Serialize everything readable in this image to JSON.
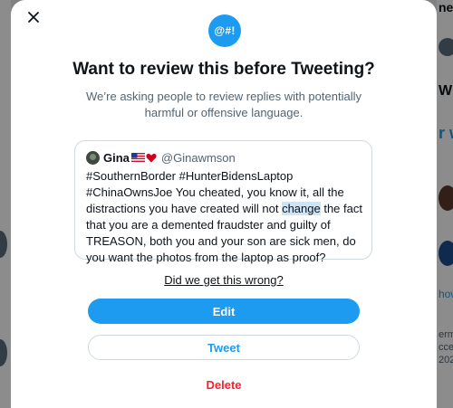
{
  "background": {
    "right_fragments": [
      "nek",
      "Wh",
      "r w",
      "how",
      "erms",
      "cces",
      "202"
    ]
  },
  "dialog": {
    "close_label": "×",
    "logo_text": "@#!",
    "title": "Want to review this before Tweeting?",
    "subtitle": "We’re asking people to review replies with potentially harmful or offensive language.",
    "tweet": {
      "author_name": "Gina",
      "author_handle": "@Ginawmson",
      "text_before_highlight": "#SouthernBorder #HunterBidensLaptop #ChinaOwnsJoe You cheated, you know it, all the distractions you have created will not ",
      "highlighted_word": "change",
      "text_after_highlight": " the fact that you are a demented fraudster and guilty of TREASON, both you and your son are sick men, do you want the photos from the laptop as proof?"
    },
    "feedback_link": "Did we get this wrong?",
    "edit_label": "Edit",
    "tweet_label": "Tweet",
    "delete_label": "Delete"
  },
  "colors": {
    "accent": "#1d9bf0",
    "danger": "#f4212e",
    "highlight": "#cce4f7"
  }
}
